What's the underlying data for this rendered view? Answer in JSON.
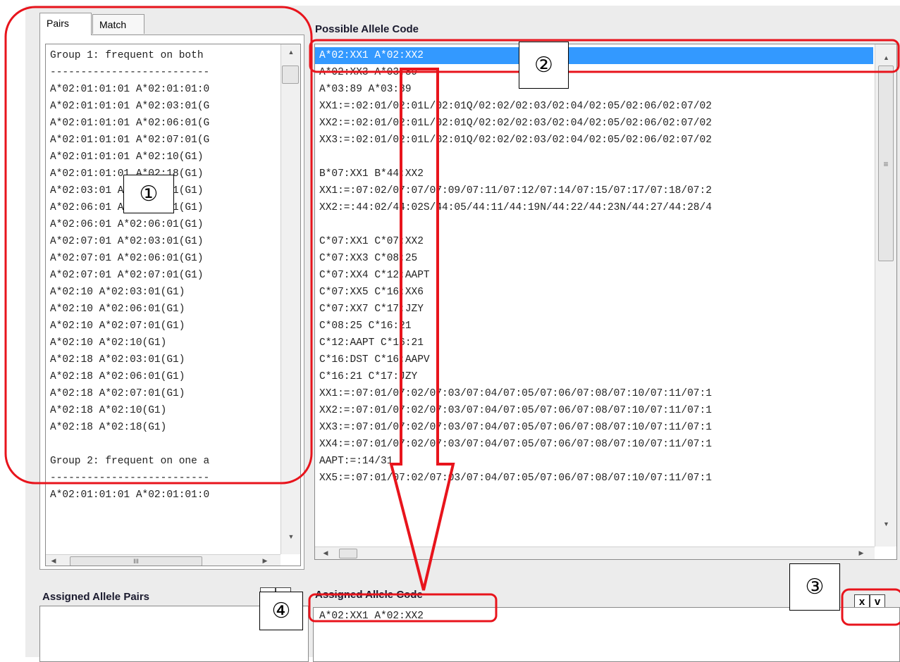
{
  "tabs": [
    {
      "label": "Pairs",
      "active": true
    },
    {
      "label": "Match",
      "active": false
    }
  ],
  "pairs_list": [
    "Group 1: frequent on both",
    "--------------------------",
    "A*02:01:01:01 A*02:01:01:0",
    "A*02:01:01:01 A*02:03:01(G",
    "A*02:01:01:01 A*02:06:01(G",
    "A*02:01:01:01 A*02:07:01(G",
    "A*02:01:01:01 A*02:10(G1)",
    "A*02:01:01:01 A*02:18(G1)",
    "A*02:03:01 A*02:03:01(G1)",
    "A*02:06:01 A*02:03:01(G1)",
    "A*02:06:01 A*02:06:01(G1)",
    "A*02:07:01 A*02:03:01(G1)",
    "A*02:07:01 A*02:06:01(G1)",
    "A*02:07:01 A*02:07:01(G1)",
    "A*02:10 A*02:03:01(G1)",
    "A*02:10 A*02:06:01(G1)",
    "A*02:10 A*02:07:01(G1)",
    "A*02:10 A*02:10(G1)",
    "A*02:18 A*02:03:01(G1)",
    "A*02:18 A*02:06:01(G1)",
    "A*02:18 A*02:07:01(G1)",
    "A*02:18 A*02:10(G1)",
    "A*02:18 A*02:18(G1)",
    "",
    "Group 2: frequent on one a",
    "--------------------------",
    "A*02:01:01:01 A*02:01:01:0"
  ],
  "possible_allele_code": {
    "title": "Possible Allele Code",
    "rows": [
      "A*02:XX1 A*02:XX2",
      "A*02:XX3 A*03:89",
      "A*03:89 A*03:89",
      "XX1:=:02:01/02:01L/02:01Q/02:02/02:03/02:04/02:05/02:06/02:07/02",
      "XX2:=:02:01/02:01L/02:01Q/02:02/02:03/02:04/02:05/02:06/02:07/02",
      "XX3:=:02:01/02:01L/02:01Q/02:02/02:03/02:04/02:05/02:06/02:07/02",
      "",
      "B*07:XX1 B*44:XX2",
      "XX1:=:07:02/07:07/07:09/07:11/07:12/07:14/07:15/07:17/07:18/07:2",
      "XX2:=:44:02/44:02S/44:05/44:11/44:19N/44:22/44:23N/44:27/44:28/4",
      "",
      "C*07:XX1 C*07:XX2",
      "C*07:XX3 C*08:25",
      "C*07:XX4 C*12:AAPT",
      "C*07:XX5 C*16:XX6",
      "C*07:XX7 C*17:JZY",
      "C*08:25 C*16:21",
      "C*12:AAPT C*16:21",
      "C*16:DST C*16:AAPV",
      "C*16:21 C*17:JZY",
      "XX1:=:07:01/07:02/07:03/07:04/07:05/07:06/07:08/07:10/07:11/07:1",
      "XX2:=:07:01/07:02/07:03/07:04/07:05/07:06/07:08/07:10/07:11/07:1",
      "XX3:=:07:01/07:02/07:03/07:04/07:05/07:06/07:08/07:10/07:11/07:1",
      "XX4:=:07:01/07:02/07:03/07:04/07:05/07:06/07:08/07:10/07:11/07:1",
      "AAPT:=:14/31",
      "XX5:=:07:01/07:02/07:03/07:04/07:05/07:06/07:08/07:10/07:11/07:1"
    ]
  },
  "assigned_allele_pairs": {
    "title": "Assigned Allele Pairs",
    "clear_label": "x",
    "accept_label": "v"
  },
  "assigned_allele_code": {
    "title": "Assigned Allele Code",
    "value": "A*02:XX1 A*02:XX2",
    "clear_label": "x",
    "accept_label": "v"
  },
  "scroll_glyphs": {
    "up": "▲",
    "down": "▼",
    "left": "◀",
    "right": "▶",
    "grip": "≡",
    "hgrip": "III"
  },
  "callouts": [
    "①",
    "②",
    "③",
    "④"
  ],
  "colors": {
    "highlight": "#e8141c",
    "selection": "#3399ff"
  }
}
